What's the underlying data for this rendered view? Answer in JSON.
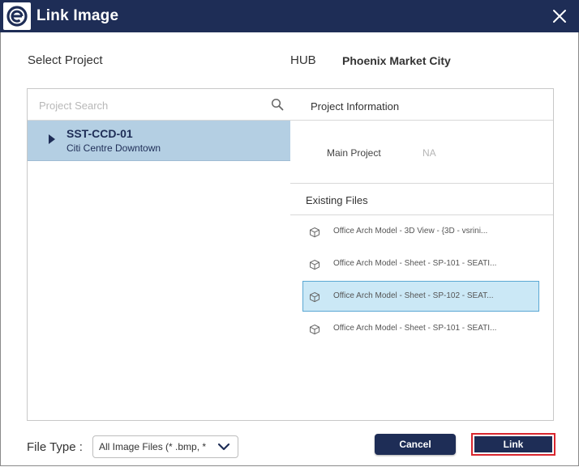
{
  "window": {
    "title": "Link Image",
    "logo_icon": "e-logo-icon",
    "close_icon": "close-icon",
    "accent_color": "#1e2d56"
  },
  "select_project": {
    "label": "Select Project",
    "search_placeholder": "Project Search",
    "search_value": "",
    "projects": [
      {
        "code": "SST-CCD-01",
        "name": "Citi Centre Downtown",
        "selected": true,
        "expanded": false
      }
    ]
  },
  "hub": {
    "label": "HUB",
    "value": "Phoenix Market City"
  },
  "project_information": {
    "header": "Project Information",
    "main_project_label": "Main Project",
    "main_project_value": "NA"
  },
  "existing_files": {
    "header": "Existing Files",
    "files": [
      {
        "name": "Office Arch Model - 3D View - {3D - vsrini...",
        "icon": "cube-icon",
        "selected": false
      },
      {
        "name": "Office Arch Model - Sheet - SP-101 - SEATI...",
        "icon": "cube-icon",
        "selected": false
      },
      {
        "name": "Office Arch Model - Sheet - SP-102 - SEAT...",
        "icon": "cube-icon",
        "selected": true
      },
      {
        "name": "Office Arch Model - Sheet - SP-101 - SEATI...",
        "icon": "cube-icon",
        "selected": false
      }
    ]
  },
  "footer": {
    "file_type_label": "File Type :",
    "file_type_value": "All Image Files (* .bmp, *",
    "cancel_label": "Cancel",
    "link_label": "Link"
  }
}
